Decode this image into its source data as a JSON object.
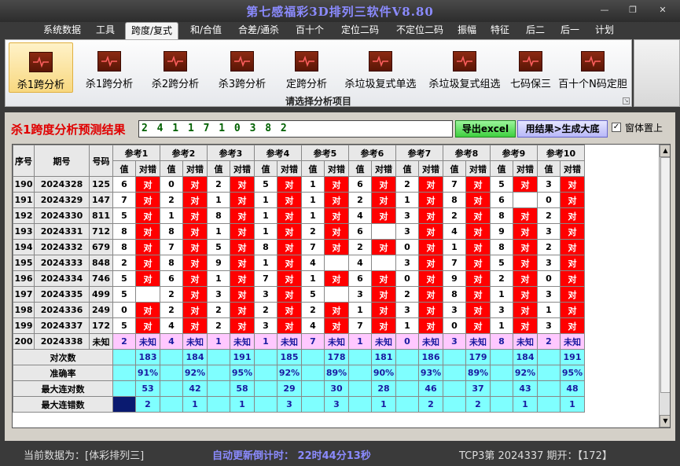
{
  "app": {
    "title": "第七感福彩3D排列三软件V8.80"
  },
  "menu": [
    {
      "label": "系统数据"
    },
    {
      "label": "工具"
    },
    {
      "label": "跨度/复式"
    },
    {
      "label": "和/合值"
    },
    {
      "label": "合差/通杀"
    },
    {
      "label": "百十个"
    },
    {
      "label": "定位二码"
    },
    {
      "label": "不定位二码"
    },
    {
      "label": "振幅"
    },
    {
      "label": "特征"
    },
    {
      "label": "后二"
    },
    {
      "label": "后一"
    },
    {
      "label": "计划"
    }
  ],
  "ribbon": {
    "buttons": [
      {
        "label": "杀1跨分析"
      },
      {
        "label": "杀1跨分析"
      },
      {
        "label": "杀2跨分析"
      },
      {
        "label": "杀3跨分析"
      },
      {
        "label": "定跨分析"
      },
      {
        "label": "杀垃圾复式单选"
      },
      {
        "label": "杀垃圾复式组选"
      },
      {
        "label": "七码保三"
      },
      {
        "label": "百十个N码定胆"
      }
    ],
    "caption": "请选择分析项目"
  },
  "result": {
    "label": "杀1跨度分析预测结果",
    "value": "2 4 1 1 7 1 0 3 8 2",
    "excel_btn": "导出excel",
    "gen_btn": "用结果>生成大底",
    "ontop_label": "窗体置上",
    "ontop_check": "✓"
  },
  "grid": {
    "headers": {
      "seq": "序号",
      "issue": "期号",
      "code": "号码",
      "refs": [
        "参考1",
        "参考2",
        "参考3",
        "参考4",
        "参考5",
        "参考6",
        "参考7",
        "参考8",
        "参考9",
        "参考10"
      ],
      "val": "值",
      "check": "对错"
    },
    "rows": [
      {
        "seq": "190",
        "issue": "2024328",
        "code": "125",
        "cells": [
          [
            "6",
            "对"
          ],
          [
            "0",
            "对"
          ],
          [
            "2",
            "对"
          ],
          [
            "5",
            "对"
          ],
          [
            "1",
            "对"
          ],
          [
            "6",
            "对"
          ],
          [
            "2",
            "对"
          ],
          [
            "7",
            "对"
          ],
          [
            "5",
            "对"
          ],
          [
            "3",
            "对"
          ]
        ]
      },
      {
        "seq": "191",
        "issue": "2024329",
        "code": "147",
        "cells": [
          [
            "7",
            "对"
          ],
          [
            "2",
            "对"
          ],
          [
            "1",
            "对"
          ],
          [
            "1",
            "对"
          ],
          [
            "1",
            "对"
          ],
          [
            "2",
            "对"
          ],
          [
            "1",
            "对"
          ],
          [
            "8",
            "对"
          ],
          [
            "6",
            ""
          ],
          [
            "0",
            "对"
          ]
        ]
      },
      {
        "seq": "192",
        "issue": "2024330",
        "code": "811",
        "cells": [
          [
            "5",
            "对"
          ],
          [
            "1",
            "对"
          ],
          [
            "8",
            "对"
          ],
          [
            "1",
            "对"
          ],
          [
            "1",
            "对"
          ],
          [
            "4",
            "对"
          ],
          [
            "3",
            "对"
          ],
          [
            "2",
            "对"
          ],
          [
            "8",
            "对"
          ],
          [
            "2",
            "对"
          ]
        ]
      },
      {
        "seq": "193",
        "issue": "2024331",
        "code": "712",
        "cells": [
          [
            "8",
            "对"
          ],
          [
            "8",
            "对"
          ],
          [
            "1",
            "对"
          ],
          [
            "1",
            "对"
          ],
          [
            "2",
            "对"
          ],
          [
            "6",
            ""
          ],
          [
            "3",
            "对"
          ],
          [
            "4",
            "对"
          ],
          [
            "9",
            "对"
          ],
          [
            "3",
            "对"
          ]
        ]
      },
      {
        "seq": "194",
        "issue": "2024332",
        "code": "679",
        "cells": [
          [
            "8",
            "对"
          ],
          [
            "7",
            "对"
          ],
          [
            "5",
            "对"
          ],
          [
            "8",
            "对"
          ],
          [
            "7",
            "对"
          ],
          [
            "2",
            "对"
          ],
          [
            "0",
            "对"
          ],
          [
            "1",
            "对"
          ],
          [
            "8",
            "对"
          ],
          [
            "2",
            "对"
          ]
        ]
      },
      {
        "seq": "195",
        "issue": "2024333",
        "code": "848",
        "cells": [
          [
            "2",
            "对"
          ],
          [
            "8",
            "对"
          ],
          [
            "9",
            "对"
          ],
          [
            "1",
            "对"
          ],
          [
            "4",
            ""
          ],
          [
            "4",
            ""
          ],
          [
            "3",
            "对"
          ],
          [
            "7",
            "对"
          ],
          [
            "5",
            "对"
          ],
          [
            "3",
            "对"
          ]
        ]
      },
      {
        "seq": "196",
        "issue": "2024334",
        "code": "746",
        "cells": [
          [
            "5",
            "对"
          ],
          [
            "6",
            "对"
          ],
          [
            "1",
            "对"
          ],
          [
            "7",
            "对"
          ],
          [
            "1",
            "对"
          ],
          [
            "6",
            "对"
          ],
          [
            "0",
            "对"
          ],
          [
            "9",
            "对"
          ],
          [
            "2",
            "对"
          ],
          [
            "0",
            "对"
          ]
        ]
      },
      {
        "seq": "197",
        "issue": "2024335",
        "code": "499",
        "cells": [
          [
            "5",
            ""
          ],
          [
            "2",
            "对"
          ],
          [
            "3",
            "对"
          ],
          [
            "3",
            "对"
          ],
          [
            "5",
            ""
          ],
          [
            "3",
            "对"
          ],
          [
            "2",
            "对"
          ],
          [
            "8",
            "对"
          ],
          [
            "1",
            "对"
          ],
          [
            "3",
            "对"
          ]
        ]
      },
      {
        "seq": "198",
        "issue": "2024336",
        "code": "249",
        "cells": [
          [
            "0",
            "对"
          ],
          [
            "2",
            "对"
          ],
          [
            "2",
            "对"
          ],
          [
            "2",
            "对"
          ],
          [
            "2",
            "对"
          ],
          [
            "1",
            "对"
          ],
          [
            "3",
            "对"
          ],
          [
            "3",
            "对"
          ],
          [
            "3",
            "对"
          ],
          [
            "1",
            "对"
          ]
        ]
      },
      {
        "seq": "199",
        "issue": "2024337",
        "code": "172",
        "cells": [
          [
            "5",
            "对"
          ],
          [
            "4",
            "对"
          ],
          [
            "2",
            "对"
          ],
          [
            "3",
            "对"
          ],
          [
            "4",
            "对"
          ],
          [
            "7",
            "对"
          ],
          [
            "1",
            "对"
          ],
          [
            "0",
            "对"
          ],
          [
            "1",
            "对"
          ],
          [
            "3",
            "对"
          ]
        ]
      }
    ],
    "pred_row": {
      "seq": "200",
      "issue": "2024338",
      "code": "未知",
      "cells": [
        [
          "2",
          "未知"
        ],
        [
          "4",
          "未知"
        ],
        [
          "1",
          "未知"
        ],
        [
          "1",
          "未知"
        ],
        [
          "7",
          "未知"
        ],
        [
          "1",
          "未知"
        ],
        [
          "0",
          "未知"
        ],
        [
          "3",
          "未知"
        ],
        [
          "8",
          "未知"
        ],
        [
          "2",
          "未知"
        ]
      ]
    },
    "stats": [
      {
        "label": "对次数",
        "values": [
          "183",
          "184",
          "191",
          "185",
          "178",
          "181",
          "186",
          "179",
          "184",
          "191"
        ]
      },
      {
        "label": "准确率",
        "values": [
          "91%",
          "92%",
          "95%",
          "92%",
          "89%",
          "90%",
          "93%",
          "89%",
          "92%",
          "95%"
        ]
      },
      {
        "label": "最大连对数",
        "values": [
          "53",
          "42",
          "58",
          "29",
          "30",
          "28",
          "46",
          "37",
          "43",
          "48"
        ]
      },
      {
        "label": "最大连错数",
        "values": [
          "2",
          "1",
          "1",
          "3",
          "3",
          "1",
          "2",
          "2",
          "1",
          "1"
        ]
      }
    ]
  },
  "status": {
    "current_data": "当前数据为：[体彩排列三]",
    "countdown": "自动更新倒计时：  22时44分13秒",
    "draw_info": "TCP3第 2024337 期开：【172】"
  },
  "colors": {
    "hit": "#ff0000",
    "stat": "#7fffff",
    "pred": "#ffc8ff",
    "title": "#8b8bff"
  }
}
